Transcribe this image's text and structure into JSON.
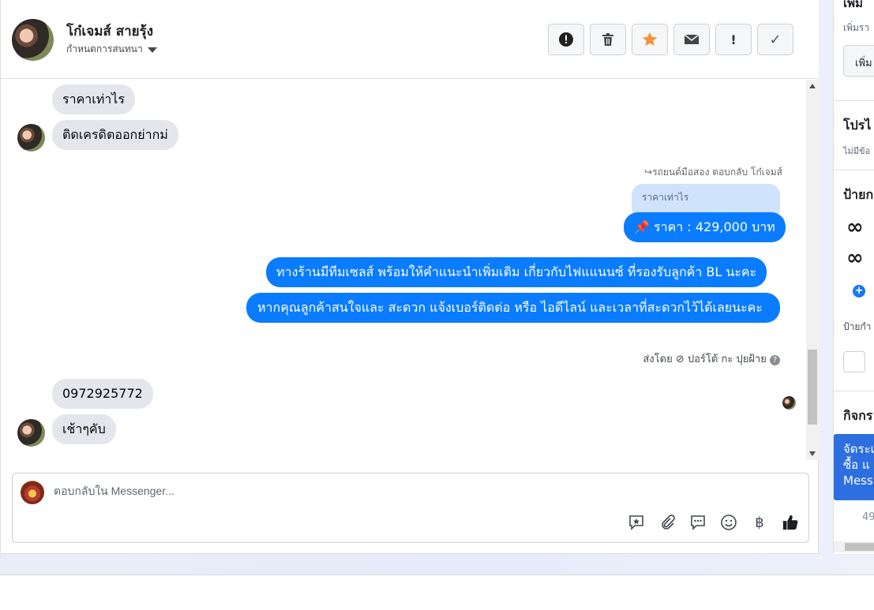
{
  "header": {
    "contact_name": "โก๋เจมส์ สายรุ้ง",
    "conversation_setting": "กำหนดการสนทนา"
  },
  "toolbar": {
    "buttons": [
      {
        "icon": "alert-circle-icon",
        "glyph": "❗"
      },
      {
        "icon": "trash-icon",
        "glyph": "🗑"
      },
      {
        "icon": "star-icon",
        "glyph": "★"
      },
      {
        "icon": "envelope-icon",
        "glyph": "✉"
      },
      {
        "icon": "exclamation-icon",
        "glyph": "!"
      },
      {
        "icon": "checkmark-icon",
        "glyph": "✓"
      }
    ]
  },
  "messages": {
    "in_1": "ราคาเท่าไร",
    "in_2": "ติดเครดิตออกย่ากม่",
    "reply_meta": "รถยนต์มือสอง ตอบกลับ โก๋เจมส์",
    "quoted": "ราคาเท่าไร",
    "out_price": "📌 ราคา : 429,000 บาท",
    "out_2": "ทางร้านมีทีมเซลส์ พร้อมให้คำแนะนำเพิ่มเติม เกี่ยวกับไฟแแนนซ์ ที่รองรับลูกค้า BL นะคะ",
    "out_3": "หากคุณลูกค้าสนใจและ สะดวก แจ้งเบอร์ติดต่อ หรือ ไอดีไลน์ และเวลาที่สะดวกไว้ได้เลยนะคะ",
    "sent_by": "ส่งโดย ⊘ ปอร์โต้ กะ ปุยฝ้าย",
    "in_3": "0972925772",
    "in_4": "เช้าๆคับ"
  },
  "reply_box": {
    "placeholder": "ตอบกลับใน Messenger...",
    "tools": [
      "saved-reply-icon",
      "attachment-icon",
      "chat-bubble-icon",
      "emoji-icon",
      "baht-icon",
      "thumbs-up-icon"
    ]
  },
  "right_panel": {
    "top_heading": "เพิ่ม",
    "add_desc": "เพิ่มรา",
    "add_btn": "เพิ่ม",
    "profile_heading": "โปรไ",
    "profile_desc": "ไม่มีข้อ",
    "labels_heading": "ป้ายก",
    "labels_desc": "ป้ายกำ",
    "activity_heading": "กิจกร",
    "banner_text": "จัดระเ ซื้อ แ Mess",
    "count": "49"
  }
}
